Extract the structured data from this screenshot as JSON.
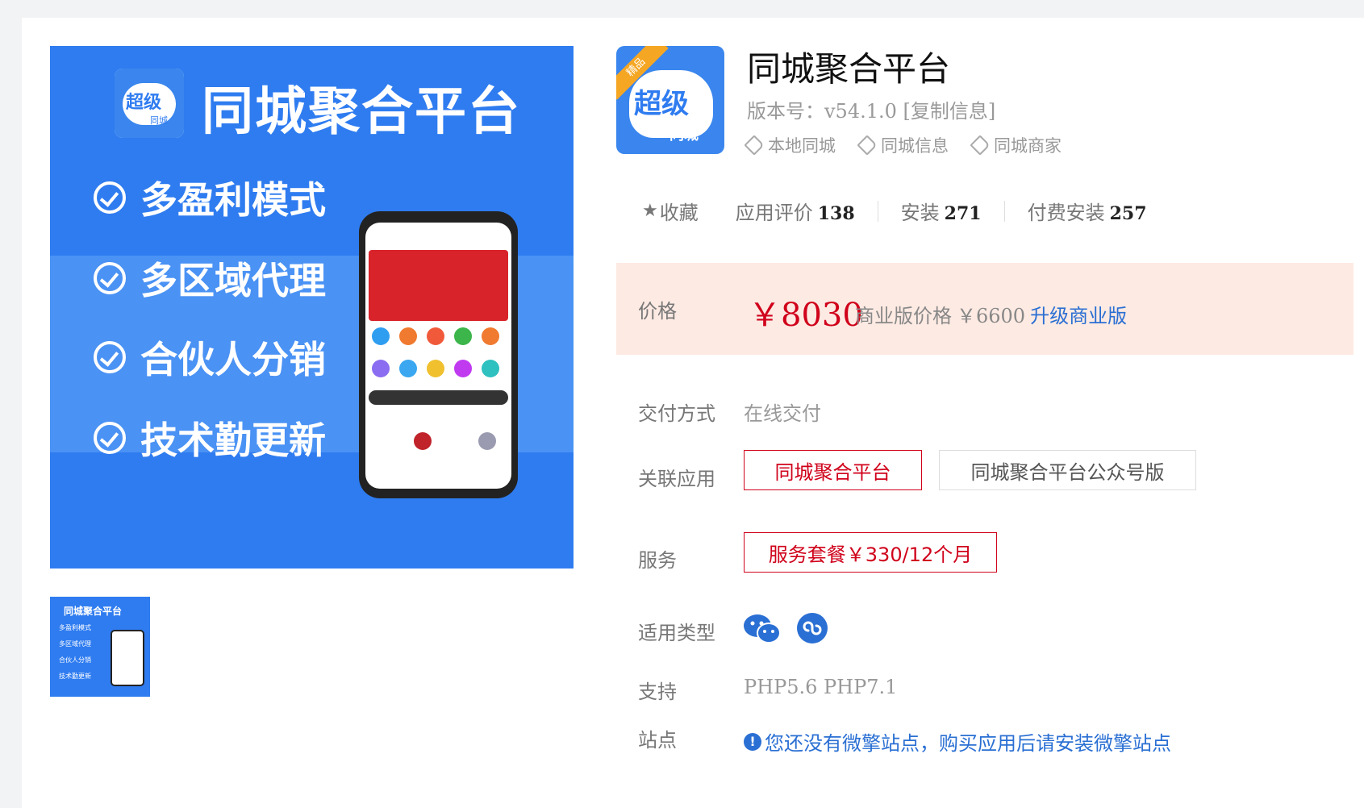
{
  "banner": {
    "title": "同城聚合平台",
    "logo_big": "超级",
    "logo_small": "同城",
    "badge": "精品",
    "features": [
      "多盈利模式",
      "多区域代理",
      "合伙人分销",
      "技术勤更新"
    ]
  },
  "thumbnail": {
    "title": "同城聚合平台",
    "features": [
      "多盈利模式",
      "多区域代理",
      "合伙人分销",
      "技术勤更新"
    ]
  },
  "app": {
    "icon_badge": "精品",
    "icon_big": "超级",
    "icon_small": "同城",
    "title": "同城聚合平台",
    "version_label": "版本号：",
    "version": "v54.1.0",
    "copy_link": "[复制信息]",
    "tags": [
      "本地同城",
      "同城信息",
      "同城商家"
    ]
  },
  "stats": {
    "favorite": "收藏",
    "rating_label": "应用评价",
    "rating_count": "138",
    "install_label": "安装",
    "install_count": "271",
    "paid_label": "付费安装",
    "paid_count": "257"
  },
  "price": {
    "label": "价格",
    "main": "￥8030",
    "business_label": "商业版价格",
    "business_price": "￥6600",
    "upgrade_link": "升级商业版"
  },
  "delivery": {
    "label": "交付方式",
    "value": "在线交付"
  },
  "related": {
    "label": "关联应用",
    "options": [
      "同城聚合平台",
      "同城聚合平台公众号版"
    ]
  },
  "service": {
    "label": "服务",
    "option": "服务套餐￥330/12个月"
  },
  "type": {
    "label": "适用类型",
    "icons": [
      "wechat-icon",
      "mini-program-icon"
    ]
  },
  "support": {
    "label": "支持",
    "value": "PHP5.6 PHP7.1"
  },
  "site": {
    "label": "站点",
    "notice": "您还没有微擎站点，购买应用后请安装微擎站点"
  },
  "colors": {
    "brand_blue": "#2f7cf0",
    "price_red": "#d0021b",
    "price_bg": "#fdeae3",
    "link_blue": "#2a6fd3"
  }
}
